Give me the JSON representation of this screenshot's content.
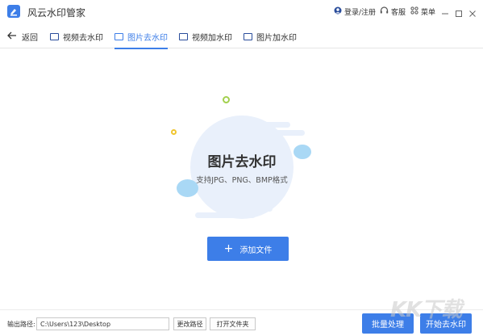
{
  "app": {
    "title": "风云水印管家",
    "login_label": "登录/注册",
    "service_label": "客服",
    "menu_label": "菜单"
  },
  "nav": {
    "back_label": "返回",
    "tabs": [
      {
        "label": "视频去水印",
        "active": false
      },
      {
        "label": "图片去水印",
        "active": true
      },
      {
        "label": "视频加水印",
        "active": false
      },
      {
        "label": "图片加水印",
        "active": false
      }
    ]
  },
  "main": {
    "heading": "图片去水印",
    "supported_formats": "支持JPG、PNG、BMP格式",
    "add_button_label": "添加文件"
  },
  "footer": {
    "output_label": "输出路径:",
    "output_path": "C:\\Users\\123\\Desktop",
    "change_path_label": "更改路径",
    "open_folder_label": "打开文件夹",
    "batch_label": "批量处理",
    "start_label": "开始去水印"
  },
  "watermark_text": "KK下载",
  "colors": {
    "accent": "#3d7ee8",
    "illustration_bg": "#e9f0fb",
    "bubble": "#a9d8f5",
    "dot_green": "#a3d04e",
    "dot_yellow": "#f0c530"
  }
}
